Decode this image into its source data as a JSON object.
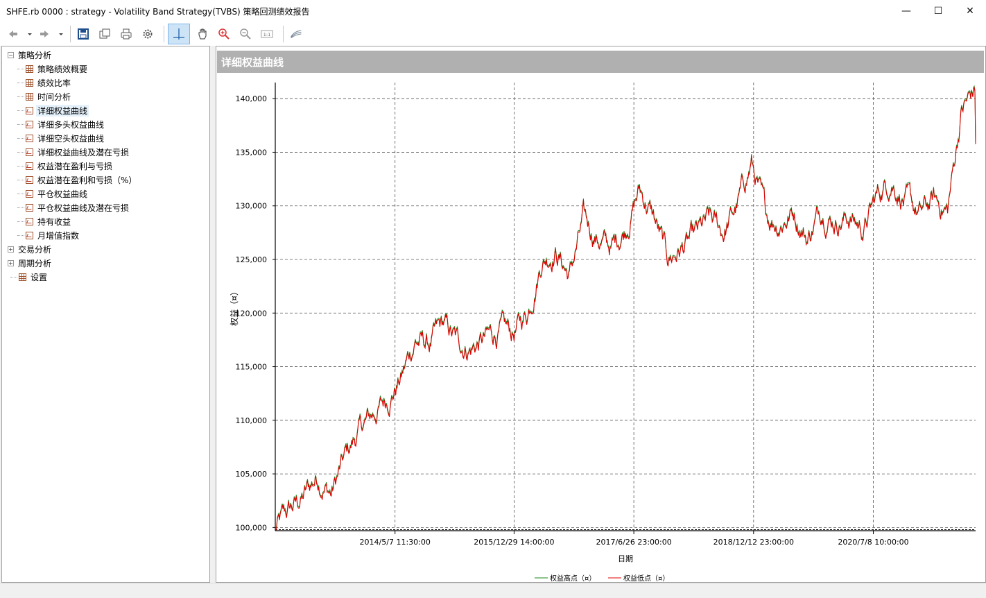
{
  "window": {
    "title": "SHFE.rb 0000 : strategy - Volatility Band Strategy(TVBS) 策略回测绩效报告",
    "controls": {
      "minimize": "—",
      "maximize": "☐",
      "close": "✕"
    }
  },
  "toolbar": {
    "icons": [
      "back-icon",
      "dropdown-icon",
      "forward-icon",
      "dropdown-icon",
      "save-icon",
      "copy-icon",
      "print-icon",
      "settings-icon",
      "crosshair-icon",
      "pan-hand-icon",
      "zoom-in-icon",
      "zoom-out-icon",
      "actual-size-icon",
      "chart-style-icon"
    ],
    "actual_size_label": "1:1"
  },
  "tree": {
    "root": "策略分析",
    "items": [
      "策略绩效概要",
      "绩效比率",
      "时间分析",
      "详细权益曲线",
      "详细多头权益曲线",
      "详细空头权益曲线",
      "详细权益曲线及潜在亏损",
      "权益潜在盈利与亏损",
      "权益潜在盈利和亏损（%）",
      "平仓权益曲线",
      "平仓权益曲线及潜在亏损",
      "持有收益",
      "月增值指数"
    ],
    "selected_index": 3,
    "others": [
      "交易分析",
      "周期分析",
      "设置"
    ]
  },
  "panel": {
    "title": "详细权益曲线"
  },
  "colors": {
    "high_series": "#1a8a1a",
    "low_series": "#e00000",
    "grid": "#555555"
  },
  "chart_data": {
    "type": "line",
    "ylabel": "权益（¤）",
    "xlabel": "日期",
    "ylim": [
      99700,
      141500
    ],
    "yticks": [
      100000,
      105000,
      110000,
      115000,
      120000,
      125000,
      130000,
      135000,
      140000
    ],
    "ytick_labels": [
      "100,000",
      "105,000",
      "110,000",
      "115,000",
      "120,000",
      "125,000",
      "130,000",
      "135,000",
      "140,000"
    ],
    "xticks": [
      "2014/5/7 11:30:00",
      "2015/12/29 14:00:00",
      "2017/6/26 23:00:00",
      "2018/12/12 23:00:00",
      "2020/7/8 10:00:00"
    ],
    "grid": true,
    "legend_position": "bottom-center",
    "series": [
      {
        "name": "权益高点（¤）",
        "color": "#1a8a1a"
      },
      {
        "name": "权益低点（¤）",
        "color": "#e00000"
      }
    ],
    "x": [
      0,
      0.02,
      0.04,
      0.06,
      0.08,
      0.1,
      0.12,
      0.14,
      0.16,
      0.18,
      0.2,
      0.22,
      0.24,
      0.26,
      0.28,
      0.3,
      0.32,
      0.34,
      0.36,
      0.38,
      0.4,
      0.42,
      0.44,
      0.46,
      0.48,
      0.5,
      0.52,
      0.54,
      0.56,
      0.58,
      0.6,
      0.62,
      0.64,
      0.66,
      0.68,
      0.7,
      0.72,
      0.74,
      0.76,
      0.78,
      0.8,
      0.82,
      0.84,
      0.86,
      0.88,
      0.9,
      0.92,
      0.94,
      0.96,
      0.98,
      1.0
    ],
    "equity": [
      99800,
      101500,
      102800,
      104800,
      103200,
      106500,
      109000,
      110500,
      112000,
      114000,
      117500,
      117000,
      118800,
      117200,
      116800,
      117500,
      118300,
      118000,
      120000,
      125000,
      126000,
      123500,
      128500,
      127000,
      126000,
      128000,
      131500,
      129000,
      125000,
      126000,
      127000,
      128500,
      127500,
      130000,
      134000,
      129000,
      128500,
      129500,
      127000,
      129800,
      128700,
      129000,
      127800,
      131000,
      132500,
      130500,
      129000,
      130500,
      129500,
      139000,
      140800
    ],
    "equity_last": 136000
  }
}
